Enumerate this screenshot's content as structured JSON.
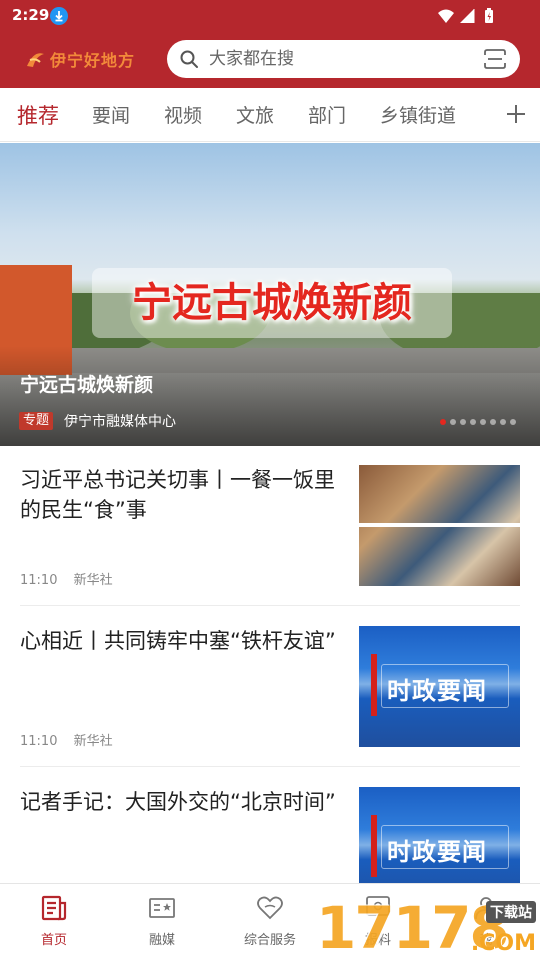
{
  "status_bar": {
    "time": "2:29"
  },
  "header": {
    "logo_text": "伊宁好地方",
    "search_placeholder": "大家都在搜"
  },
  "tabs": [
    {
      "label": "推荐",
      "active": true
    },
    {
      "label": "要闻"
    },
    {
      "label": "视频"
    },
    {
      "label": "文旅"
    },
    {
      "label": "部门"
    },
    {
      "label": "乡镇街道"
    }
  ],
  "banner": {
    "headline": "宁远古城焕新颜",
    "title": "宁远古城焕新颜",
    "badge": "专题",
    "source": "伊宁市融媒体中心",
    "slides": 8,
    "active_slide": 1
  },
  "news": [
    {
      "title": "习近平总书记关切事丨一餐一饭里的民生“食”事",
      "time": "11:10",
      "source": "新华社",
      "thumb": "photo"
    },
    {
      "title": "心相近丨共同铸牢中塞“铁杆友谊”",
      "time": "11:10",
      "source": "新华社",
      "thumb": "politics",
      "thumb_label": "时政要闻"
    },
    {
      "title": "记者手记：大国外交的“北京时间”",
      "thumb": "politics",
      "thumb_label": "时政要闻"
    }
  ],
  "bottom_nav": [
    {
      "label": "首页",
      "icon": "home-news-icon",
      "active": true
    },
    {
      "label": "融媒",
      "icon": "media-icon"
    },
    {
      "label": "综合服务",
      "icon": "heart-service-icon"
    },
    {
      "label": "报料",
      "icon": "report-icon"
    },
    {
      "label": "我",
      "icon": "user-icon"
    }
  ],
  "watermark": {
    "number": "17178",
    "tag": "下载站",
    "domain": ".COM"
  },
  "colors": {
    "brand": "#b5272d",
    "accent": "#e4271f"
  }
}
